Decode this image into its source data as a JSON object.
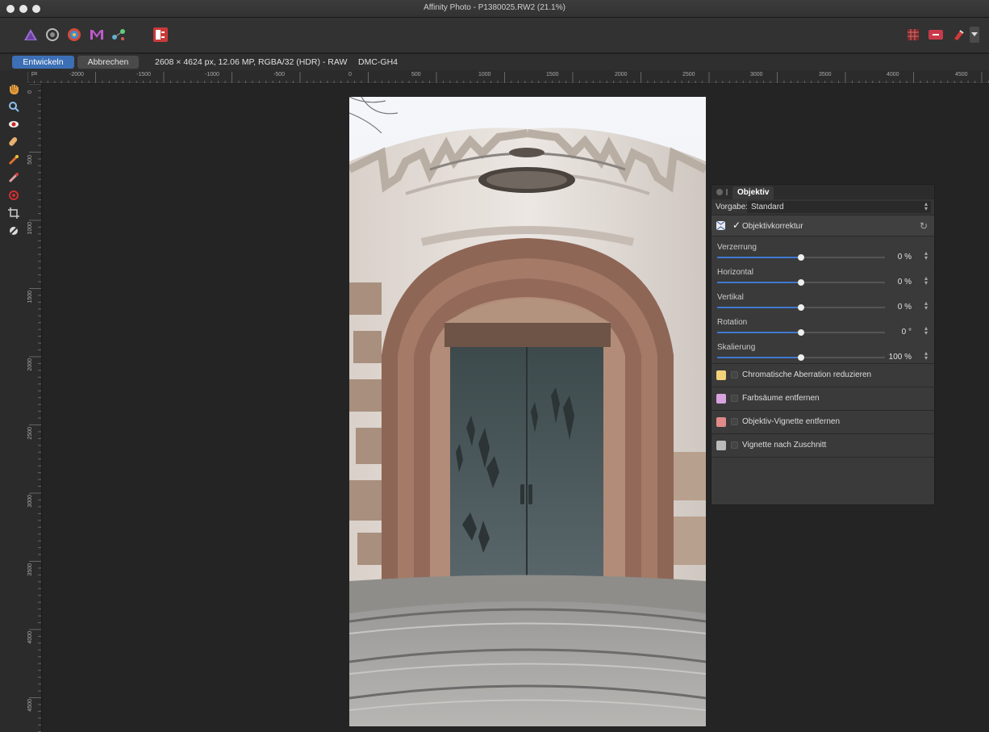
{
  "window": {
    "title": "Affinity Photo - P1380025.RW2 (21.1%)"
  },
  "context": {
    "develop_label": "Entwickeln",
    "cancel_label": "Abbrechen",
    "image_info": "2608 × 4624 px, 12.06 MP, RGBA/32 (HDR) - RAW",
    "camera": "DMC-GH4"
  },
  "ruler": {
    "unit": "px",
    "h_ticks": [
      "-2000",
      "-1500",
      "-1000",
      "-500",
      "0",
      "500",
      "1000",
      "1500",
      "2000",
      "2500",
      "3000",
      "3500",
      "4000",
      "4500"
    ],
    "v_ticks": [
      "0",
      "500",
      "1000",
      "1500",
      "2000",
      "2500",
      "3000",
      "3500",
      "4000",
      "4500"
    ]
  },
  "panel": {
    "tab": "Objektiv",
    "preset_label": "Vorgabe:",
    "preset_value": "Standard",
    "section_label": "Objektivkorrektur",
    "check_mark": "✓",
    "sliders": [
      {
        "label": "Verzerrung",
        "value": "0 %",
        "level": 0.5
      },
      {
        "label": "Horizontal",
        "value": "0 %",
        "level": 0.5
      },
      {
        "label": "Vertikal",
        "value": "0 %",
        "level": 0.5
      },
      {
        "label": "Rotation",
        "value": "0 °",
        "level": 0.5
      },
      {
        "label": "Skalierung",
        "value": "100 %",
        "level": 0.5
      }
    ],
    "options": [
      {
        "label": "Chromatische Aberration reduzieren",
        "color": "#f2d27a"
      },
      {
        "label": "Farbsäume entfernen",
        "color": "#d9a3e0"
      },
      {
        "label": "Objektiv-Vignette entfernen",
        "color": "#e08a8a"
      },
      {
        "label": "Vignette nach Zuschnitt",
        "color": "#bbbbbb"
      }
    ]
  },
  "colors": {
    "accent": "#3c6fb5",
    "slider_fill": "#3f79d0"
  }
}
